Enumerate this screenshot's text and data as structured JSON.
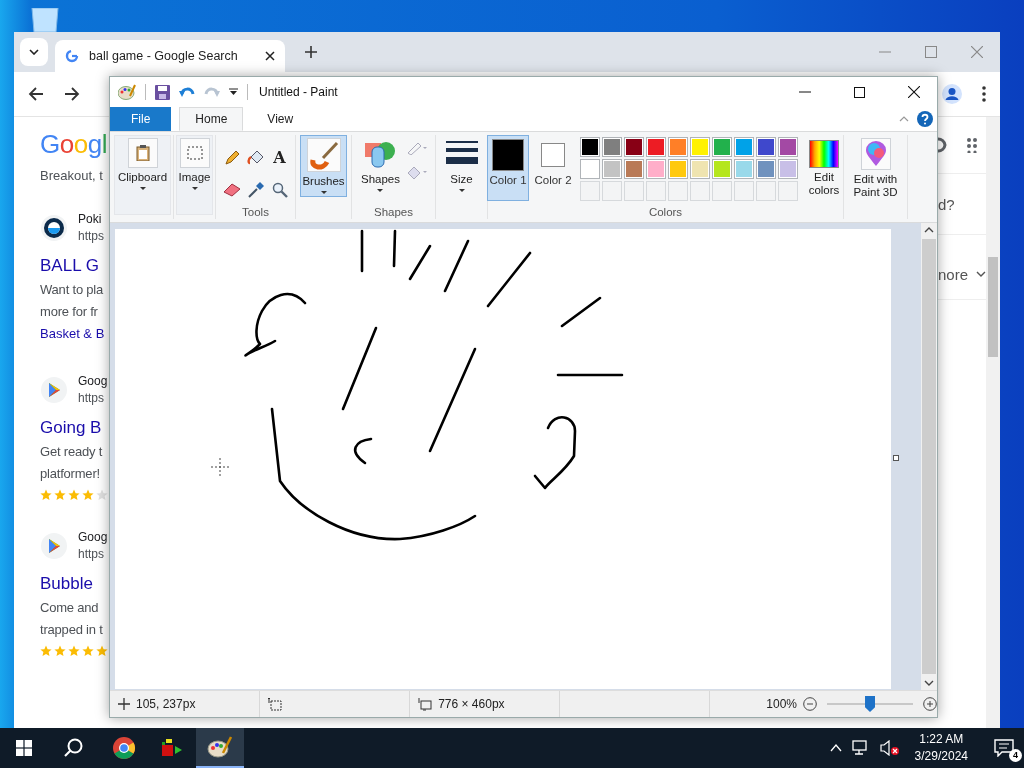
{
  "browser": {
    "tabs": [
      {
        "title": "ball game - Google Search",
        "selected": true
      }
    ],
    "logo": "Googl",
    "peek_text": "Breakout, t",
    "results": [
      {
        "kind": "poki",
        "source": "Poki",
        "url": "https",
        "title": "BALL G",
        "snippet": [
          "Want to pla",
          "more for fr"
        ],
        "link": "Basket & B"
      },
      {
        "kind": "play_store",
        "source": "Goog",
        "url": "https",
        "title": "Going B",
        "snippet": [
          "Get ready t",
          "platformer!"
        ],
        "stars": 4
      },
      {
        "kind": "play_store",
        "source": "Goog",
        "url": "https",
        "title": "Bubble",
        "snippet": [
          "Come and",
          "trapped in t"
        ],
        "stars": 5
      }
    ],
    "side_texts": [
      "d?",
      "nore"
    ]
  },
  "paint": {
    "title": "Untitled - Paint",
    "tabs": [
      {
        "label": "File",
        "kind": "file",
        "selected": false
      },
      {
        "label": "Home",
        "kind": "tab",
        "selected": true
      },
      {
        "label": "View",
        "kind": "tab",
        "selected": false
      }
    ],
    "clipboard": "Clipboard",
    "image": "Image",
    "tools": "Tools",
    "text_tool_glyph": "A",
    "brushes": {
      "label": "Brushes",
      "selected": true
    },
    "shapes": "Shapes",
    "shapes_group": "Shapes",
    "size": "Size",
    "color_slots": [
      {
        "label": "Color 1",
        "color": "#000000",
        "selected": true
      },
      {
        "label": "Color 2",
        "color": "#ffffff",
        "selected": false
      }
    ],
    "palette": [
      {
        "color": "#000000"
      },
      {
        "color": "#7f7f7f"
      },
      {
        "color": "#880015"
      },
      {
        "color": "#ed1c24"
      },
      {
        "color": "#ff7f27"
      },
      {
        "color": "#fff200"
      },
      {
        "color": "#22b14c"
      },
      {
        "color": "#00a2e8"
      },
      {
        "color": "#3f48cc"
      },
      {
        "color": "#a349a4"
      },
      {
        "color": "#ffffff"
      },
      {
        "color": "#c3c3c3"
      },
      {
        "color": "#b97a57"
      },
      {
        "color": "#ffaec9"
      },
      {
        "color": "#ffc90e"
      },
      {
        "color": "#efe4b0"
      },
      {
        "color": "#b5e61d"
      },
      {
        "color": "#99d9ea"
      },
      {
        "color": "#7092be"
      },
      {
        "color": "#c8bfe7"
      }
    ],
    "edit_colors": "Edit colors",
    "colors_group": "Colors",
    "paint3d": "Edit with Paint 3D",
    "status": {
      "cursor": "105, 237px",
      "canvas_size": "776 × 460px",
      "zoom": "100%",
      "zoom_slider": {
        "level": 0.5
      }
    }
  },
  "taskbar": {
    "apps": [
      {
        "kind": "chrome",
        "selected": false
      },
      {
        "kind": "app",
        "selected": false
      },
      {
        "kind": "paint",
        "selected": true
      }
    ],
    "time": "1:22 AM",
    "date": "3/29/2024",
    "notifications": "4"
  }
}
